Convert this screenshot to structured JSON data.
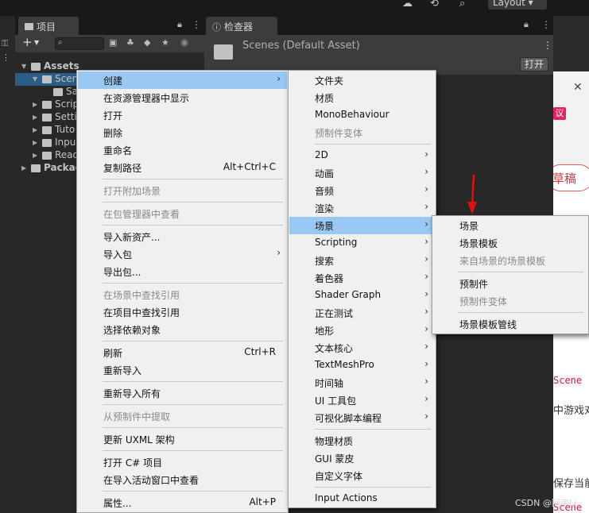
{
  "topbar": {
    "layout_label": "Layout ▾"
  },
  "project_panel": {
    "tab_label": "项目",
    "tree": [
      {
        "label": "Assets",
        "level": 0,
        "expanded": true
      },
      {
        "label": "Scen",
        "level": 1,
        "expanded": true,
        "selected": true
      },
      {
        "label": "Sa",
        "level": 2
      },
      {
        "label": "Scrip",
        "level": 1
      },
      {
        "label": "Setti",
        "level": 1
      },
      {
        "label": "Tuto",
        "level": 1
      },
      {
        "label": "Inpu",
        "level": 1
      },
      {
        "label": "Read",
        "level": 1
      },
      {
        "label": "Packag",
        "level": 0
      }
    ]
  },
  "inspector": {
    "tab_label": "检查器",
    "asset_title": "Scenes (Default Asset)",
    "open_button": "打开"
  },
  "context_menu": {
    "items": [
      {
        "label": "创建",
        "submenu": true,
        "highlighted": true
      },
      {
        "label": "在资源管理器中显示"
      },
      {
        "label": "打开"
      },
      {
        "label": "删除"
      },
      {
        "label": "重命名"
      },
      {
        "label": "复制路径",
        "shortcut": "Alt+Ctrl+C"
      },
      {
        "separator": true
      },
      {
        "label": "打开附加场景",
        "disabled": true
      },
      {
        "separator": true
      },
      {
        "label": "在包管理器中查看",
        "disabled": true
      },
      {
        "separator": true
      },
      {
        "label": "导入新资产..."
      },
      {
        "label": "导入包",
        "submenu": true
      },
      {
        "label": "导出包..."
      },
      {
        "separator": true
      },
      {
        "label": "在场景中查找引用",
        "disabled": true
      },
      {
        "label": "在项目中查找引用"
      },
      {
        "label": "选择依赖对象"
      },
      {
        "separator": true
      },
      {
        "label": "刷新",
        "shortcut": "Ctrl+R"
      },
      {
        "label": "重新导入"
      },
      {
        "separator": true
      },
      {
        "label": "重新导入所有"
      },
      {
        "separator": true
      },
      {
        "label": "从预制件中提取",
        "disabled": true
      },
      {
        "separator": true
      },
      {
        "label": "更新 UXML 架构"
      },
      {
        "separator": true
      },
      {
        "label": "打开 C# 项目"
      },
      {
        "label": "在导入活动窗口中查看"
      },
      {
        "separator": true
      },
      {
        "label": "属性...",
        "shortcut": "Alt+P"
      }
    ]
  },
  "create_submenu": {
    "items": [
      {
        "label": "文件夹"
      },
      {
        "label": "材质"
      },
      {
        "label": "MonoBehaviour"
      },
      {
        "label": "预制件变体",
        "disabled": true
      },
      {
        "separator": true
      },
      {
        "label": "2D",
        "submenu": true
      },
      {
        "label": "动画",
        "submenu": true
      },
      {
        "label": "音频",
        "submenu": true
      },
      {
        "label": "渲染",
        "submenu": true
      },
      {
        "label": "场景",
        "submenu": true,
        "highlighted": true
      },
      {
        "label": "Scripting",
        "submenu": true
      },
      {
        "label": "搜索",
        "submenu": true
      },
      {
        "label": "着色器",
        "submenu": true
      },
      {
        "label": "Shader Graph",
        "submenu": true
      },
      {
        "label": "正在测试",
        "submenu": true
      },
      {
        "label": "地形",
        "submenu": true
      },
      {
        "label": "文本核心",
        "submenu": true
      },
      {
        "label": "TextMeshPro",
        "submenu": true
      },
      {
        "label": "时间轴",
        "submenu": true
      },
      {
        "label": "UI 工具包",
        "submenu": true
      },
      {
        "label": "可视化脚本编程",
        "submenu": true
      },
      {
        "separator": true
      },
      {
        "label": "物理材质"
      },
      {
        "label": "GUI 蒙皮"
      },
      {
        "label": "自定义字体"
      },
      {
        "separator": true
      },
      {
        "label": "Input Actions"
      }
    ]
  },
  "scene_submenu": {
    "items": [
      {
        "label": "场景"
      },
      {
        "label": "场景模板"
      },
      {
        "label": "来自场景的场景模板",
        "disabled": true
      },
      {
        "separator": true
      },
      {
        "label": "预制件"
      },
      {
        "label": "预制件变体",
        "disabled": true
      },
      {
        "separator": true
      },
      {
        "label": "场景模板管线"
      }
    ]
  },
  "web_snippets": {
    "badge": "议",
    "draft_button": "草稿",
    "code1": "Scene",
    "text1": "中游戏对",
    "text2": "保存当前",
    "code2": "Scene"
  },
  "watermark": "CSDN @阿宇Li",
  "colors": {
    "menu_bg": "#f0f0f0",
    "menu_highlight": "#99c9f2",
    "selection": "#2c5d87",
    "arrow": "#e01010"
  }
}
